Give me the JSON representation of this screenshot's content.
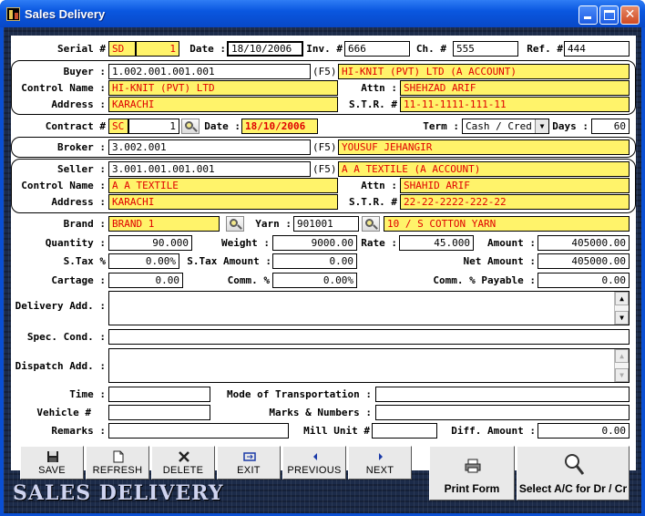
{
  "window": {
    "title": "Sales Delivery"
  },
  "header": {
    "serial_label": "Serial #",
    "serial_prefix": "SD",
    "serial_no": "1",
    "date_label": "Date :",
    "date": "18/10/2006",
    "inv_label": "Inv. #",
    "inv": "666",
    "ch_label": "Ch. #",
    "ch": "555",
    "ref_label": "Ref. #",
    "ref": "444"
  },
  "buyer": {
    "buyer_label": "Buyer :",
    "buyer_code": "1.002.001.001.001",
    "f5": "(F5)",
    "buyer_name": "HI-KNIT (PVT) LTD (A ACCOUNT)",
    "control_label": "Control Name :",
    "control_name": "HI-KNIT (PVT) LTD",
    "attn_label": "Attn :",
    "attn": "SHEHZAD ARIF",
    "address_label": "Address :",
    "address": "KARACHI",
    "str_label": "S.T.R. #",
    "str": "11-11-1111-111-11"
  },
  "contract": {
    "contract_label": "Contract #",
    "contract_prefix": "SC",
    "contract_no": "1",
    "date_label": "Date :",
    "date": "18/10/2006",
    "term_label": "Term :",
    "term": "Cash / Cred",
    "days_label": "Days :",
    "days": "60"
  },
  "broker": {
    "label": "Broker :",
    "code": "3.002.001",
    "f5": "(F5)",
    "name": "YOUSUF JEHANGIR"
  },
  "seller": {
    "seller_label": "Seller :",
    "seller_code": "3.001.001.001.001",
    "f5": "(F5)",
    "seller_name": "A A TEXTILE (A ACCOUNT)",
    "control_label": "Control Name :",
    "control_name": "A A TEXTILE",
    "attn_label": "Attn :",
    "attn": "SHAHID ARIF",
    "address_label": "Address :",
    "address": "KARACHI",
    "str_label": "S.T.R. #",
    "str": "22-22-2222-222-22"
  },
  "goods": {
    "brand_label": "Brand :",
    "brand": "BRAND 1",
    "yarn_label": "Yarn :",
    "yarn_code": "901001",
    "yarn_name": "10 / S COTTON YARN",
    "quantity_label": "Quantity :",
    "quantity": "90.000",
    "weight_label": "Weight :",
    "weight": "9000.00",
    "rate_label": "Rate :",
    "rate": "45.000",
    "amount_label": "Amount :",
    "amount": "405000.00",
    "stax_pct_label": "S.Tax %",
    "stax_pct": "0.00%",
    "stax_amount_label": "S.Tax Amount :",
    "stax_amount": "0.00",
    "net_amount_label": "Net Amount :",
    "net_amount": "405000.00",
    "cartage_label": "Cartage :",
    "cartage": "0.00",
    "comm_pct_label": "Comm. %",
    "comm_pct": "0.00%",
    "comm_payable_label": "Comm. % Payable :",
    "comm_payable": "0.00"
  },
  "notes": {
    "delivery_label": "Delivery Add. :",
    "delivery": "",
    "spec_label": "Spec. Cond. :",
    "spec": "",
    "dispatch_label": "Dispatch Add. :",
    "dispatch": "",
    "time_label": "Time :",
    "time": "",
    "mode_label": "Mode of Transportation :",
    "mode": "",
    "vehicle_label": "Vehicle #",
    "vehicle": "",
    "marks_label": "Marks & Numbers :",
    "marks": "",
    "remarks_label": "Remarks :",
    "remarks": "",
    "mill_label": "Mill Unit #",
    "mill": "",
    "diff_label": "Diff. Amount :",
    "diff": "0.00"
  },
  "toolbar": {
    "save": "SAVE",
    "refresh": "REFRESH",
    "delete": "DELETE",
    "exit": "EXIT",
    "previous": "PREVIOUS",
    "next": "NEXT",
    "print": "Print Form",
    "select_ac": "Select A/C for Dr / Cr"
  },
  "banner": "SALES DELIVERY"
}
